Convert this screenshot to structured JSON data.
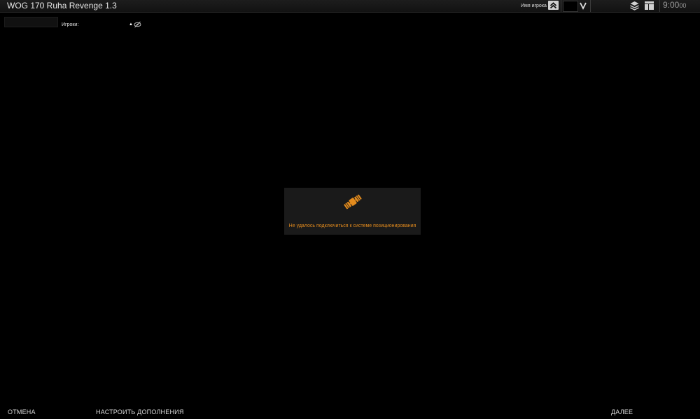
{
  "topbar": {
    "title": "WOG 170 Ruha Revenge 1.3",
    "player_label": "Имя игрока",
    "clock_main": "9:00",
    "clock_seconds": "00",
    "icons": [
      "chevron-up-icon",
      "chevron-down-icon",
      "layers-icon",
      "layout-icon"
    ]
  },
  "filter": {
    "players_label": "Игроки:",
    "sort_glyph": "▲",
    "icons": [
      "eye-off-icon"
    ]
  },
  "error_panel": {
    "message": "Не удалось подключиться к системе позиционирования",
    "icon": "satellite-icon",
    "accent_color": "#e38b1d"
  },
  "bottom_bar": {
    "cancel": "ОТМЕНА",
    "configure_addons": "НАСТРОИТЬ ДОПОЛНЕНИЯ",
    "next": "ДАЛЕЕ"
  }
}
